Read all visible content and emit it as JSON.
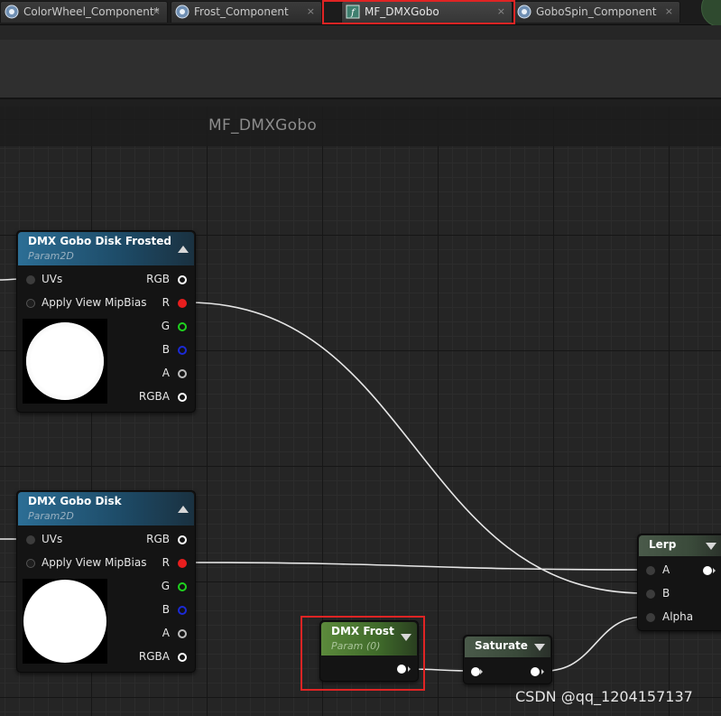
{
  "tabs": [
    {
      "label": "ColorWheel_Component*",
      "close": "×",
      "icon": "material-function-icon"
    },
    {
      "label": "Frost_Component",
      "close": "×",
      "icon": "material-function-icon"
    },
    {
      "label": "MF_DMXGobo",
      "close": "×",
      "icon": "material-function-icon"
    },
    {
      "label": "GoboSpin_Component",
      "close": "×",
      "icon": "material-function-icon"
    }
  ],
  "graph": {
    "title": "MF_DMXGobo"
  },
  "nodes": {
    "frosted": {
      "title": "DMX Gobo Disk Frosted",
      "subtitle": "Param2D",
      "inputs": [
        "UVs",
        "Apply View MipBias"
      ],
      "outputs": [
        "RGB",
        "R",
        "G",
        "B",
        "A",
        "RGBA"
      ]
    },
    "disk": {
      "title": "DMX Gobo Disk",
      "subtitle": "Param2D",
      "inputs": [
        "UVs",
        "Apply View MipBias"
      ],
      "outputs": [
        "RGB",
        "R",
        "G",
        "B",
        "A",
        "RGBA"
      ]
    },
    "frost": {
      "title": "DMX Frost",
      "subtitle": "Param (0)"
    },
    "saturate": {
      "title": "Saturate"
    },
    "lerp": {
      "title": "Lerp",
      "inputs": [
        "A",
        "B",
        "Alpha"
      ]
    }
  },
  "colors": {
    "pin_r": "#e81e1e",
    "pin_g": "#1fd21f",
    "pin_b": "#1b2ad6",
    "highlight": "#e02424",
    "wire": "#e6e6e6"
  },
  "watermark": "CSDN @qq_1204157137"
}
